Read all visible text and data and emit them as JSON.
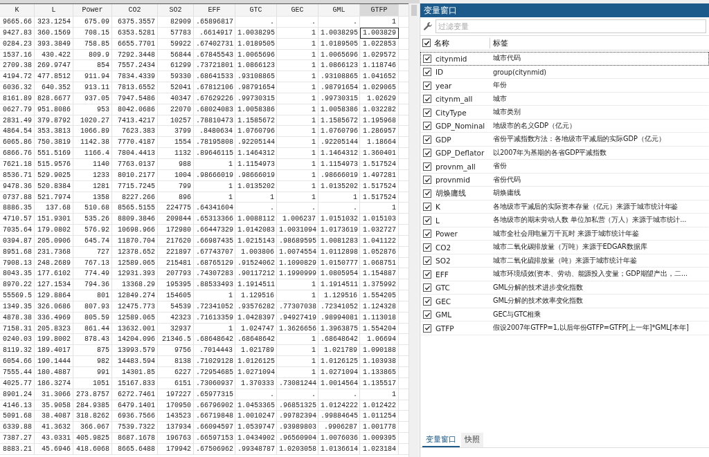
{
  "grid": {
    "columns": [
      {
        "label": "K",
        "selected": false
      },
      {
        "label": "L",
        "selected": false
      },
      {
        "label": "Power",
        "selected": false
      },
      {
        "label": "CO2",
        "selected": false
      },
      {
        "label": "SO2",
        "selected": false
      },
      {
        "label": "EFF",
        "selected": false
      },
      {
        "label": "GTC",
        "selected": false
      },
      {
        "label": "GEC",
        "selected": false
      },
      {
        "label": "GML",
        "selected": false
      },
      {
        "label": "GTFP",
        "selected": true
      }
    ],
    "rows": [
      {
        "selected": false,
        "cells": [
          "9665.66",
          "323.1254",
          "675.09",
          "6375.3557",
          "82909",
          ".65896817",
          ".",
          ".",
          ".",
          "1"
        ]
      },
      {
        "selected": true,
        "cells": [
          "9427.83",
          "360.1569",
          "708.15",
          "6353.5281",
          "57783",
          ".6614917",
          "1.0038295",
          "1",
          "1.0038295",
          "1.003829"
        ]
      },
      {
        "selected": false,
        "cells": [
          "0284.23",
          "393.3849",
          "758.85",
          "6655.7701",
          "59922",
          ".67402731",
          "1.0189505",
          "1",
          "1.0189505",
          "1.022853"
        ]
      },
      {
        "selected": false,
        "cells": [
          "1537.16",
          "430.422",
          "809.9",
          "7292.3448",
          "56844",
          ".67845543",
          "1.0065696",
          "1",
          "1.0065696",
          "1.029572"
        ]
      },
      {
        "selected": false,
        "cells": [
          "2709.38",
          "269.9747",
          "854",
          "7557.2434",
          "61299",
          ".73721801",
          "1.0866123",
          "1",
          "1.0866123",
          "1.118746"
        ]
      },
      {
        "selected": false,
        "cells": [
          "4194.72",
          "477.8512",
          "911.94",
          "7834.4339",
          "59330",
          ".68641533",
          ".93108865",
          "1",
          ".93108865",
          "1.041652"
        ]
      },
      {
        "selected": false,
        "cells": [
          "6036.32",
          "640.352",
          "913.11",
          "7813.6552",
          "52041",
          ".67812106",
          ".98791654",
          "1",
          ".98791654",
          "1.029065"
        ]
      },
      {
        "selected": false,
        "cells": [
          "8161.89",
          "828.6677",
          "937.05",
          "7947.5486",
          "40347",
          ".67629226",
          ".99730315",
          "1",
          ".99730315",
          "1.02629"
        ]
      },
      {
        "selected": false,
        "cells": [
          "0627.79",
          "951.8086",
          "953",
          "8042.0686",
          "22070",
          ".68024083",
          "1.0058386",
          "1",
          "1.0058386",
          "1.032282"
        ]
      },
      {
        "selected": false,
        "cells": [
          "2831.49",
          "379.8792",
          "1020.27",
          "7413.4217",
          "10257",
          ".78810473",
          "1.1585672",
          "1",
          "1.1585672",
          "1.195968"
        ]
      },
      {
        "selected": false,
        "cells": [
          "4864.54",
          "353.3813",
          "1066.89",
          "7623.383",
          "3799",
          ".8480634",
          "1.0760796",
          "1",
          "1.0760796",
          "1.286957"
        ]
      },
      {
        "selected": false,
        "cells": [
          "6065.86",
          "750.3819",
          "1142.38",
          "7770.4187",
          "1554",
          ".78195808",
          ".92205144",
          "1",
          ".92205144",
          "1.18664"
        ]
      },
      {
        "selected": false,
        "cells": [
          "6866.76",
          "551.5169",
          "1166.4",
          "7804.4413",
          "1132",
          ".89646115",
          "1.1464312",
          "1",
          "1.1464312",
          "1.360401"
        ]
      },
      {
        "selected": false,
        "cells": [
          "7621.18",
          "515.9576",
          "1140",
          "7763.0137",
          "988",
          "1",
          "1.1154973",
          "1",
          "1.1154973",
          "1.517524"
        ]
      },
      {
        "selected": false,
        "cells": [
          "8536.71",
          "529.9025",
          "1233",
          "8010.2177",
          "1004",
          ".98666019",
          ".98666019",
          "1",
          ".98666019",
          "1.497281"
        ]
      },
      {
        "selected": false,
        "cells": [
          "9478.36",
          "520.8384",
          "1281",
          "7715.7245",
          "799",
          "1",
          "1.0135202",
          "1",
          "1.0135202",
          "1.517524"
        ]
      },
      {
        "selected": false,
        "cells": [
          "0737.88",
          "521.7974",
          "1358",
          "8227.266",
          "896",
          "1",
          "1",
          "1",
          "1",
          "1.517524"
        ]
      },
      {
        "selected": false,
        "cells": [
          "8886.35",
          "137.68",
          "510.68",
          "8565.5155",
          "224775",
          ".64341604",
          ".",
          ".",
          ".",
          "1"
        ]
      },
      {
        "selected": false,
        "cells": [
          "4710.57",
          "151.9301",
          "535.26",
          "8809.3846",
          "209844",
          ".65313366",
          "1.0088112",
          "1.006237",
          "1.0151032",
          "1.015103"
        ]
      },
      {
        "selected": false,
        "cells": [
          "7035.64",
          "179.0802",
          "576.92",
          "10698.966",
          "172980",
          ".66447329",
          "1.0142083",
          "1.0031094",
          "1.0173619",
          "1.032727"
        ]
      },
      {
        "selected": false,
        "cells": [
          "0394.87",
          "205.0906",
          "645.74",
          "11870.704",
          "217620",
          ".66987435",
          "1.0215143",
          ".98689595",
          "1.0081283",
          "1.041122"
        ]
      },
      {
        "selected": false,
        "cells": [
          "8951.68",
          "231.7368",
          "727",
          "12378.652",
          "221897",
          ".67743707",
          "1.003806",
          "1.0074554",
          "1.0112898",
          "1.052876"
        ]
      },
      {
        "selected": false,
        "cells": [
          "7908.13",
          "248.2689",
          "767.13",
          "12589.065",
          "215481",
          ".68765129",
          ".91524062",
          "1.1090829",
          "1.0150777",
          "1.068751"
        ]
      },
      {
        "selected": false,
        "cells": [
          "8043.35",
          "177.6102",
          "774.49",
          "12931.393",
          "207793",
          ".74307283",
          ".90117212",
          "1.1990999",
          "1.0805954",
          "1.154887"
        ]
      },
      {
        "selected": false,
        "cells": [
          "8970.22",
          "127.1534",
          "794.36",
          "13368.29",
          "195395",
          ".88533493",
          "1.1914511",
          "1",
          "1.1914511",
          "1.375992"
        ]
      },
      {
        "selected": false,
        "cells": [
          "55569.5",
          "129.8864",
          "801",
          "12849.274",
          "154605",
          "1",
          "1.129516",
          "1",
          "1.129516",
          "1.554205"
        ]
      },
      {
        "selected": false,
        "cells": [
          "1349.35",
          "326.0686",
          "807.93",
          "12475.773",
          "54539",
          ".72341052",
          ".93576282",
          ".77307038",
          ".72341052",
          "1.124328"
        ]
      },
      {
        "selected": false,
        "cells": [
          "4878.38",
          "336.4969",
          "805.59",
          "12589.065",
          "42323",
          ".71613359",
          "1.0428397",
          ".94927419",
          ".98994081",
          "1.113018"
        ]
      },
      {
        "selected": false,
        "cells": [
          "7158.31",
          "205.8323",
          "861.44",
          "13632.001",
          "32937",
          "1",
          "1.024747",
          "1.3626656",
          "1.3963875",
          "1.554204"
        ]
      },
      {
        "selected": false,
        "cells": [
          "0240.03",
          "199.8002",
          "878.43",
          "14204.096",
          "21346.5",
          ".68648642",
          ".68648642",
          "1",
          ".68648642",
          "1.06694"
        ]
      },
      {
        "selected": false,
        "cells": [
          "8119.32",
          "189.4017",
          "875",
          "13993.579",
          "9756",
          ".7014443",
          "1.021789",
          "1",
          "1.021789",
          "1.090188"
        ]
      },
      {
        "selected": false,
        "cells": [
          "6054.66",
          "190.1444",
          "982",
          "14483.594",
          "8138",
          ".71029128",
          "1.0126125",
          "1",
          "1.0126125",
          "1.103938"
        ]
      },
      {
        "selected": false,
        "cells": [
          "7555.44",
          "180.4887",
          "991",
          "14301.85",
          "6227",
          ".72954685",
          "1.0271094",
          "1",
          "1.0271094",
          "1.133865"
        ]
      },
      {
        "selected": false,
        "cells": [
          "4025.77",
          "186.3274",
          "1051",
          "15167.833",
          "6151",
          ".73060937",
          "1.370333",
          ".73081244",
          "1.0014564",
          "1.135517"
        ]
      },
      {
        "selected": false,
        "cells": [
          "8901.24",
          "31.3066",
          "273.8757",
          "6272.7461",
          "197227",
          ".65977315",
          ".",
          ".",
          ".",
          "1"
        ]
      },
      {
        "selected": false,
        "cells": [
          "4146.13",
          "35.9058",
          "284.9385",
          "6479.1401",
          "170950",
          ".66796902",
          "1.0453365",
          ".96851325",
          "1.0124222",
          "1.012422"
        ]
      },
      {
        "selected": false,
        "cells": [
          "5091.68",
          "38.4087",
          "318.8262",
          "6936.7566",
          "143523",
          ".66719848",
          "1.0010247",
          ".99782394",
          ".99884645",
          "1.011254"
        ]
      },
      {
        "selected": false,
        "cells": [
          "6339.88",
          "41.3632",
          "366.067",
          "7539.7322",
          "137934",
          ".66094597",
          "1.0539747",
          ".93989803",
          ".9906287",
          "1.001778"
        ]
      },
      {
        "selected": false,
        "cells": [
          "7387.27",
          "43.0331",
          "405.9825",
          "8687.1678",
          "196763",
          ".66597153",
          "1.0434902",
          ".96560904",
          "1.0076036",
          "1.009395"
        ]
      },
      {
        "selected": false,
        "cells": [
          "8883.21",
          "45.6946",
          "418.6068",
          "8665.6488",
          "179942",
          ".67506962",
          ".99348787",
          "1.0203058",
          "1.0136614",
          "1.023184"
        ]
      }
    ]
  },
  "variables_window": {
    "title": "变量窗口",
    "filter": {
      "placeholder": "过滤变量"
    },
    "header": {
      "checked": true,
      "name": "名称",
      "label": "标签"
    },
    "variables": [
      {
        "name": "citynmid",
        "label": "城市代码",
        "checked": true,
        "selected": true
      },
      {
        "name": "ID",
        "label": "group(citynmid)",
        "checked": true,
        "selected": false
      },
      {
        "name": "year",
        "label": "年份",
        "checked": true,
        "selected": false
      },
      {
        "name": "citynm_all",
        "label": "城市",
        "checked": true,
        "selected": false
      },
      {
        "name": "CityType",
        "label": "城市类别",
        "checked": true,
        "selected": false
      },
      {
        "name": "GDP_Nominal",
        "label": "地级市的名义GDP（亿元）",
        "checked": true,
        "selected": false
      },
      {
        "name": "GDP",
        "label": "省份平减指数方法：各地级市平减后的实际GDP（亿元）",
        "checked": true,
        "selected": false
      },
      {
        "name": "GDP_Deflator",
        "label": "以2007年为基期的各省GDP平减指数",
        "checked": true,
        "selected": false
      },
      {
        "name": "provnm_all",
        "label": "省份",
        "checked": true,
        "selected": false
      },
      {
        "name": "provnmid",
        "label": "省份代码",
        "checked": true,
        "selected": false
      },
      {
        "name": "胡焕庸线",
        "label": "胡焕庸线",
        "checked": true,
        "selected": false
      },
      {
        "name": "K",
        "label": "各地级市平减后的实际资本存量（亿元）来源于城市统计年鉴",
        "checked": true,
        "selected": false
      },
      {
        "name": "L",
        "label": "各地级市的期末劳动人数 单位加私营（万人）来源于城市统计...",
        "checked": true,
        "selected": false
      },
      {
        "name": "Power",
        "label": "城市全社会用电量万千瓦时 来源于城市统计年鉴",
        "checked": true,
        "selected": false
      },
      {
        "name": "CO2",
        "label": "城市二氧化碳排放量（万吨）来源于EDGAR数据库",
        "checked": true,
        "selected": false
      },
      {
        "name": "SO2",
        "label": "城市二氧化硫排放量（吨）来源于城市统计年鉴",
        "checked": true,
        "selected": false
      },
      {
        "name": "EFF",
        "label": "城市环境绩效(资本、劳动、能源投入变量；GDP期望产出，二...",
        "checked": true,
        "selected": false
      },
      {
        "name": "GTC",
        "label": "GML分解的技术进步变化指数",
        "checked": true,
        "selected": false
      },
      {
        "name": "GEC",
        "label": "GML分解的技术效率变化指数",
        "checked": true,
        "selected": false
      },
      {
        "name": "GML",
        "label": "GEC与GTC相乘",
        "checked": true,
        "selected": false
      },
      {
        "name": "GTFP",
        "label": "假设2007年GTFP=1,以后年份GTFP=GTFP[上一年]*GML[本年]",
        "checked": true,
        "selected": false
      }
    ],
    "tabs": [
      {
        "label": "变量窗口",
        "selected": true
      },
      {
        "label": "快照",
        "selected": false
      }
    ]
  }
}
